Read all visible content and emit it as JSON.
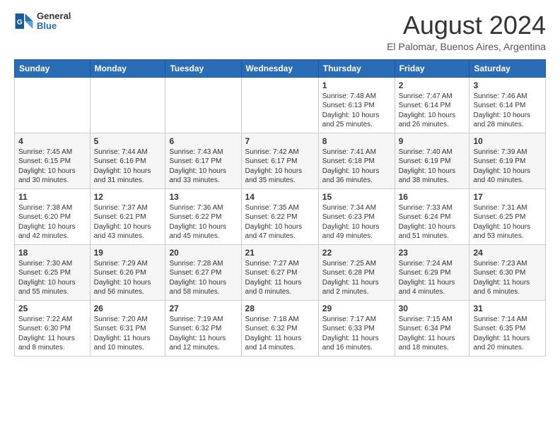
{
  "logo": {
    "general": "General",
    "blue": "Blue"
  },
  "title": "August 2024",
  "subtitle": "El Palomar, Buenos Aires, Argentina",
  "days_of_week": [
    "Sunday",
    "Monday",
    "Tuesday",
    "Wednesday",
    "Thursday",
    "Friday",
    "Saturday"
  ],
  "weeks": [
    [
      {
        "day": "",
        "info": ""
      },
      {
        "day": "",
        "info": ""
      },
      {
        "day": "",
        "info": ""
      },
      {
        "day": "",
        "info": ""
      },
      {
        "day": "1",
        "info": "Sunrise: 7:48 AM\nSunset: 6:13 PM\nDaylight: 10 hours and 25 minutes."
      },
      {
        "day": "2",
        "info": "Sunrise: 7:47 AM\nSunset: 6:14 PM\nDaylight: 10 hours and 26 minutes."
      },
      {
        "day": "3",
        "info": "Sunrise: 7:46 AM\nSunset: 6:14 PM\nDaylight: 10 hours and 28 minutes."
      }
    ],
    [
      {
        "day": "4",
        "info": "Sunrise: 7:45 AM\nSunset: 6:15 PM\nDaylight: 10 hours and 30 minutes."
      },
      {
        "day": "5",
        "info": "Sunrise: 7:44 AM\nSunset: 6:16 PM\nDaylight: 10 hours and 31 minutes."
      },
      {
        "day": "6",
        "info": "Sunrise: 7:43 AM\nSunset: 6:17 PM\nDaylight: 10 hours and 33 minutes."
      },
      {
        "day": "7",
        "info": "Sunrise: 7:42 AM\nSunset: 6:17 PM\nDaylight: 10 hours and 35 minutes."
      },
      {
        "day": "8",
        "info": "Sunrise: 7:41 AM\nSunset: 6:18 PM\nDaylight: 10 hours and 36 minutes."
      },
      {
        "day": "9",
        "info": "Sunrise: 7:40 AM\nSunset: 6:19 PM\nDaylight: 10 hours and 38 minutes."
      },
      {
        "day": "10",
        "info": "Sunrise: 7:39 AM\nSunset: 6:19 PM\nDaylight: 10 hours and 40 minutes."
      }
    ],
    [
      {
        "day": "11",
        "info": "Sunrise: 7:38 AM\nSunset: 6:20 PM\nDaylight: 10 hours and 42 minutes."
      },
      {
        "day": "12",
        "info": "Sunrise: 7:37 AM\nSunset: 6:21 PM\nDaylight: 10 hours and 43 minutes."
      },
      {
        "day": "13",
        "info": "Sunrise: 7:36 AM\nSunset: 6:22 PM\nDaylight: 10 hours and 45 minutes."
      },
      {
        "day": "14",
        "info": "Sunrise: 7:35 AM\nSunset: 6:22 PM\nDaylight: 10 hours and 47 minutes."
      },
      {
        "day": "15",
        "info": "Sunrise: 7:34 AM\nSunset: 6:23 PM\nDaylight: 10 hours and 49 minutes."
      },
      {
        "day": "16",
        "info": "Sunrise: 7:33 AM\nSunset: 6:24 PM\nDaylight: 10 hours and 51 minutes."
      },
      {
        "day": "17",
        "info": "Sunrise: 7:31 AM\nSunset: 6:25 PM\nDaylight: 10 hours and 53 minutes."
      }
    ],
    [
      {
        "day": "18",
        "info": "Sunrise: 7:30 AM\nSunset: 6:25 PM\nDaylight: 10 hours and 55 minutes."
      },
      {
        "day": "19",
        "info": "Sunrise: 7:29 AM\nSunset: 6:26 PM\nDaylight: 10 hours and 56 minutes."
      },
      {
        "day": "20",
        "info": "Sunrise: 7:28 AM\nSunset: 6:27 PM\nDaylight: 10 hours and 58 minutes."
      },
      {
        "day": "21",
        "info": "Sunrise: 7:27 AM\nSunset: 6:27 PM\nDaylight: 11 hours and 0 minutes."
      },
      {
        "day": "22",
        "info": "Sunrise: 7:25 AM\nSunset: 6:28 PM\nDaylight: 11 hours and 2 minutes."
      },
      {
        "day": "23",
        "info": "Sunrise: 7:24 AM\nSunset: 6:29 PM\nDaylight: 11 hours and 4 minutes."
      },
      {
        "day": "24",
        "info": "Sunrise: 7:23 AM\nSunset: 6:30 PM\nDaylight: 11 hours and 6 minutes."
      }
    ],
    [
      {
        "day": "25",
        "info": "Sunrise: 7:22 AM\nSunset: 6:30 PM\nDaylight: 11 hours and 8 minutes."
      },
      {
        "day": "26",
        "info": "Sunrise: 7:20 AM\nSunset: 6:31 PM\nDaylight: 11 hours and 10 minutes."
      },
      {
        "day": "27",
        "info": "Sunrise: 7:19 AM\nSunset: 6:32 PM\nDaylight: 11 hours and 12 minutes."
      },
      {
        "day": "28",
        "info": "Sunrise: 7:18 AM\nSunset: 6:32 PM\nDaylight: 11 hours and 14 minutes."
      },
      {
        "day": "29",
        "info": "Sunrise: 7:17 AM\nSunset: 6:33 PM\nDaylight: 11 hours and 16 minutes."
      },
      {
        "day": "30",
        "info": "Sunrise: 7:15 AM\nSunset: 6:34 PM\nDaylight: 11 hours and 18 minutes."
      },
      {
        "day": "31",
        "info": "Sunrise: 7:14 AM\nSunset: 6:35 PM\nDaylight: 11 hours and 20 minutes."
      }
    ]
  ]
}
